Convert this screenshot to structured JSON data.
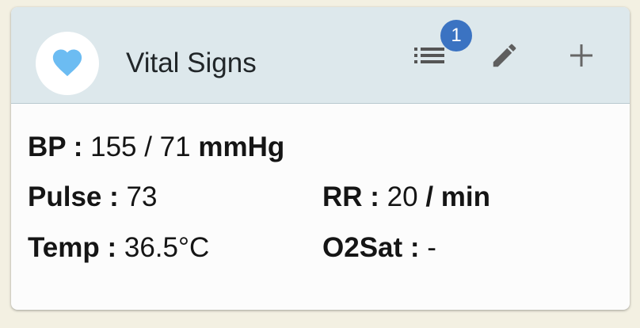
{
  "header": {
    "title": "Vital Signs",
    "notification_count": "1",
    "icons": {
      "avatar": "heart-icon",
      "list": "list-icon",
      "edit": "pencil-icon",
      "add": "plus-icon"
    }
  },
  "vitals": {
    "bp": {
      "label": "BP",
      "separator": " : ",
      "value": "155 / 71",
      "unit": "mmHg"
    },
    "pulse": {
      "label": "Pulse",
      "separator": " : ",
      "value": "73"
    },
    "rr": {
      "label": "RR",
      "separator": " : ",
      "value": "20",
      "unit": "/ min"
    },
    "temp": {
      "label": "Temp",
      "separator": " : ",
      "value": "36.5°C"
    },
    "o2sat": {
      "label": "O2Sat",
      "separator": " : ",
      "value": "-"
    }
  },
  "colors": {
    "page_bg": "#f3f0e2",
    "header_bg": "#dde8ec",
    "heart": "#6cbcf2",
    "badge": "#3b73c2",
    "icon_gray": "#666666"
  }
}
